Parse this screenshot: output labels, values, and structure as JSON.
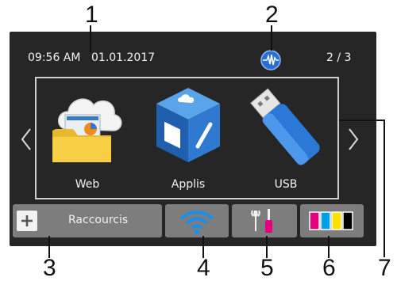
{
  "status_bar": {
    "time": "09:56 AM",
    "date": "01.01.2017",
    "page_indicator": "2 / 3"
  },
  "tiles": [
    {
      "label": "Web",
      "icon": "web-folder-cloud-icon"
    },
    {
      "label": "Applis",
      "icon": "apps-cube-icon"
    },
    {
      "label": "USB",
      "icon": "usb-drive-icon"
    }
  ],
  "bottom_bar": {
    "shortcuts_label": "Raccourcis"
  },
  "callouts": [
    "1",
    "2",
    "3",
    "4",
    "5",
    "6",
    "7"
  ],
  "colors": {
    "screen_bg": "#262626",
    "button_bg": "#7d7d7d",
    "wifi_blue": "#1a8fe8",
    "ink_magenta": "#e6007e",
    "ink_cyan": "#00a0e9",
    "ink_yellow": "#ffe100",
    "ink_black": "#000000"
  }
}
